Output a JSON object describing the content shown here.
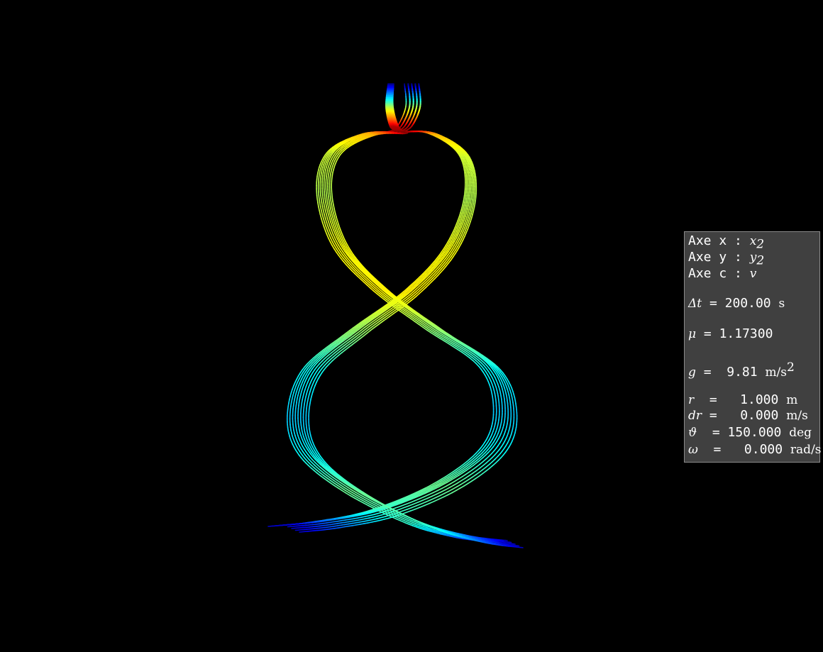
{
  "info_panel": {
    "axes": [
      {
        "label": "Axe x : ",
        "var": "x",
        "sub": "2"
      },
      {
        "label": "Axe y : ",
        "var": "y",
        "sub": "2"
      },
      {
        "label": "Axe c : ",
        "var": "v",
        "sub": ""
      }
    ],
    "dt": {
      "symbol": "Δt",
      "eq": " = 200.00 ",
      "unit": "s"
    },
    "mu": {
      "symbol": "μ",
      "eq": " = 1.17300"
    },
    "g": {
      "symbol": "g",
      "eq": " =  9.81 ",
      "unit": "m/s",
      "sup": "2"
    },
    "params": [
      {
        "symbol": "r",
        "eq": "  =   1.000 ",
        "unit": "m"
      },
      {
        "symbol": "dr",
        "eq": " =   0.000 ",
        "unit": "m/s"
      },
      {
        "symbol": "ϑ",
        "eq": "  = 150.000 ",
        "unit": "deg"
      },
      {
        "symbol": "ω",
        "eq": "  =   0.000 ",
        "unit": "rad/s"
      }
    ]
  },
  "chart_data": {
    "type": "line",
    "title": "",
    "xlabel": "x₂",
    "ylabel": "y₂",
    "color_variable": "v",
    "colormap": "jet",
    "grid": false,
    "axes_visible": false,
    "background": "#000000",
    "panel_color": "#404040",
    "trajectory_count": 9,
    "trajectory_shape": "figure-eight, repeated near-identical loops",
    "duration_s": 200.0,
    "mu": 1.173,
    "g": 9.81,
    "initial": {
      "r": 1.0,
      "dr": 0.0,
      "theta_deg": 150.0,
      "omega": 0.0
    }
  }
}
